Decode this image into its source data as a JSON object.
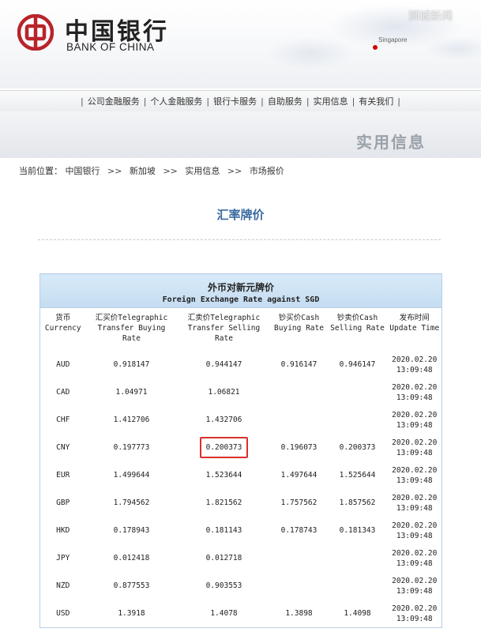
{
  "header": {
    "brand_cn": "中国银行",
    "brand_en": "BANK OF CHINA",
    "map_label": "Singapore",
    "watermark": "狮城新闻",
    "brand_color": "#b8242a"
  },
  "nav": {
    "items": [
      "公司金融服务",
      "个人金融服务",
      "银行卡服务",
      "自助服务",
      "实用信息",
      "有关我们"
    ],
    "separator": "|"
  },
  "banner": {
    "title": "实用信息"
  },
  "breadcrumb": {
    "prefix": "当前位置：",
    "items": [
      "中国银行",
      "新加坡",
      "实用信息",
      "市场报价"
    ],
    "arrow": ">>"
  },
  "page_title": "汇率牌价",
  "table": {
    "title_cn": "外币对新元牌价",
    "title_en": "Foreign Exchange Rate against SGD",
    "columns": [
      [
        "货币",
        "Currency"
      ],
      [
        "汇买价Telegraphic",
        "Transfer Buying",
        "Rate"
      ],
      [
        "汇卖价Telegraphic",
        "Transfer Selling",
        "Rate"
      ],
      [
        "钞买价Cash",
        "Buying Rate"
      ],
      [
        "钞卖价Cash",
        "Selling Rate"
      ],
      [
        "发布时间",
        "Update Time"
      ]
    ],
    "rows": [
      {
        "currency": "AUD",
        "tt_buy": "0.918147",
        "tt_sell": "0.944147",
        "cash_buy": "0.916147",
        "cash_sell": "0.946147",
        "date": "2020.02.20",
        "time": "13:09:48"
      },
      {
        "currency": "CAD",
        "tt_buy": "1.04971",
        "tt_sell": "1.06821",
        "cash_buy": "",
        "cash_sell": "",
        "date": "2020.02.20",
        "time": "13:09:48"
      },
      {
        "currency": "CHF",
        "tt_buy": "1.412706",
        "tt_sell": "1.432706",
        "cash_buy": "",
        "cash_sell": "",
        "date": "2020.02.20",
        "time": "13:09:48"
      },
      {
        "currency": "CNY",
        "tt_buy": "0.197773",
        "tt_sell": "0.200373",
        "cash_buy": "0.196073",
        "cash_sell": "0.200373",
        "date": "2020.02.20",
        "time": "13:09:48",
        "highlight": "tt_sell"
      },
      {
        "currency": "EUR",
        "tt_buy": "1.499644",
        "tt_sell": "1.523644",
        "cash_buy": "1.497644",
        "cash_sell": "1.525644",
        "date": "2020.02.20",
        "time": "13:09:48"
      },
      {
        "currency": "GBP",
        "tt_buy": "1.794562",
        "tt_sell": "1.821562",
        "cash_buy": "1.757562",
        "cash_sell": "1.857562",
        "date": "2020.02.20",
        "time": "13:09:48"
      },
      {
        "currency": "HKD",
        "tt_buy": "0.178943",
        "tt_sell": "0.181143",
        "cash_buy": "0.178743",
        "cash_sell": "0.181343",
        "date": "2020.02.20",
        "time": "13:09:48"
      },
      {
        "currency": "JPY",
        "tt_buy": "0.012418",
        "tt_sell": "0.012718",
        "cash_buy": "",
        "cash_sell": "",
        "date": "2020.02.20",
        "time": "13:09:48"
      },
      {
        "currency": "NZD",
        "tt_buy": "0.877553",
        "tt_sell": "0.903553",
        "cash_buy": "",
        "cash_sell": "",
        "date": "2020.02.20",
        "time": "13:09:48"
      },
      {
        "currency": "USD",
        "tt_buy": "1.3918",
        "tt_sell": "1.4078",
        "cash_buy": "1.3898",
        "cash_sell": "1.4098",
        "date": "2020.02.20",
        "time": "13:09:48"
      }
    ],
    "header_color": "#c9def2",
    "highlight_color": "#d9302c"
  }
}
